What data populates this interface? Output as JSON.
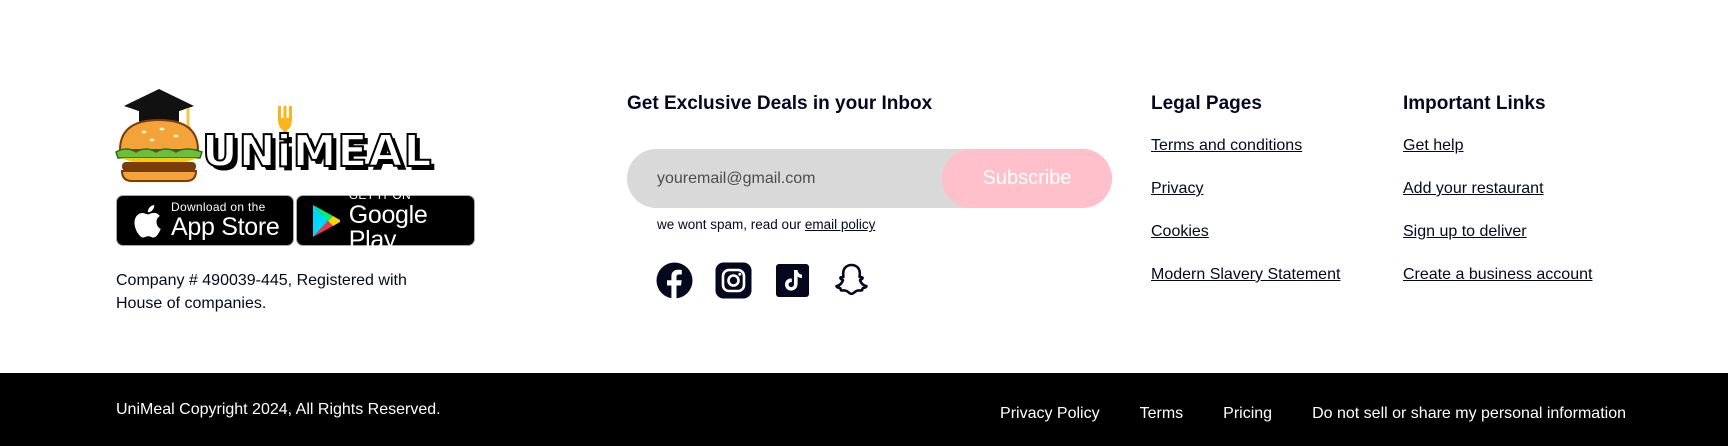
{
  "brand": {
    "name": "UNiMEAL"
  },
  "badges": {
    "apple_small": "Download on the",
    "apple_large": "App Store",
    "google_small": "GET IT ON",
    "google_large": "Google Play"
  },
  "company_info": "Company # 490039-445, Registered with House of companies.",
  "newsletter": {
    "heading": "Get Exclusive Deals in your Inbox",
    "placeholder": "youremail@gmail.com",
    "button": "Subscribe",
    "note_prefix": "we wont spam, read our ",
    "note_link": "email policy"
  },
  "socials": [
    {
      "icon": "facebook-icon"
    },
    {
      "icon": "instagram-icon"
    },
    {
      "icon": "tiktok-icon"
    },
    {
      "icon": "snapchat-icon"
    }
  ],
  "legal": {
    "heading": "Legal Pages",
    "links": [
      "Terms and conditions",
      "Privacy",
      "Cookies",
      "Modern Slavery Statement"
    ]
  },
  "important": {
    "heading": "Important Links",
    "links": [
      "Get help",
      "Add your restaurant",
      "Sign up to deliver",
      "Create a business account"
    ]
  },
  "bottom": {
    "copyright": "UniMeal Copyright 2024, All Rights Reserved.",
    "links": [
      "Privacy Policy",
      "Terms",
      "Pricing",
      "Do not sell or share my personal information"
    ]
  },
  "colors": {
    "accent_pink": "#ffc0cb",
    "input_bg": "#d9d9d9",
    "bottom_bar": "#000000",
    "text_dark": "#03081f",
    "bun": "#f4a23a",
    "fork": "#f9b51a"
  }
}
